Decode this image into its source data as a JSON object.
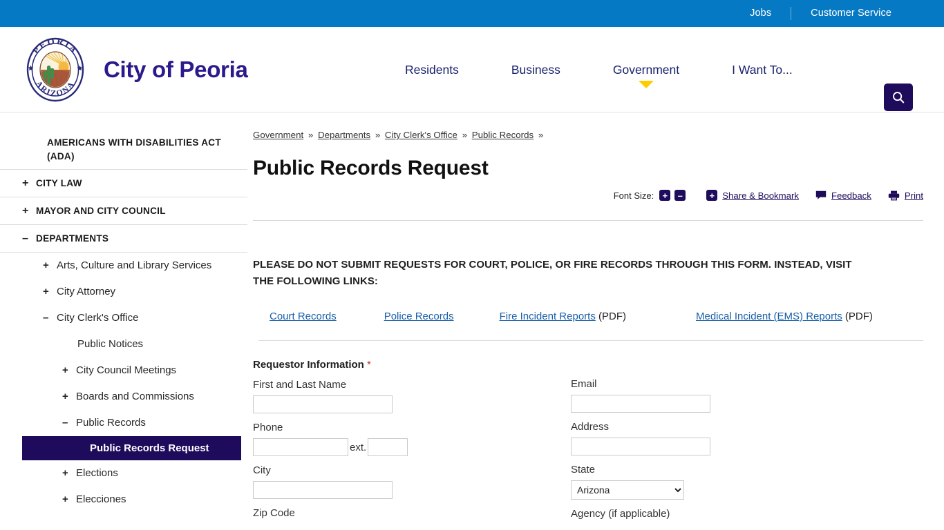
{
  "topbar": {
    "links": [
      {
        "label": "Jobs"
      },
      {
        "label": "Customer Service"
      }
    ]
  },
  "header": {
    "brand_name": "City of Peoria",
    "seal": {
      "top_text": "PEORIA",
      "bottom_text": "ARIZONA"
    },
    "nav": [
      {
        "label": "Residents",
        "active": false
      },
      {
        "label": "Business",
        "active": false
      },
      {
        "label": "Government",
        "active": true
      },
      {
        "label": "I Want To...",
        "active": false
      }
    ],
    "search_icon": "search-icon"
  },
  "sidebar": {
    "items": [
      {
        "label": "AMERICANS WITH DISABILITIES ACT (ADA)",
        "toggle": "",
        "level": 0
      },
      {
        "label": "CITY LAW",
        "toggle": "+",
        "level": 0
      },
      {
        "label": "MAYOR AND CITY COUNCIL",
        "toggle": "+",
        "level": 0
      },
      {
        "label": "DEPARTMENTS",
        "toggle": "–",
        "level": 0
      },
      {
        "label": "Arts, Culture and Library Services",
        "toggle": "+",
        "level": 1
      },
      {
        "label": "City Attorney",
        "toggle": "+",
        "level": 1
      },
      {
        "label": "City Clerk's Office",
        "toggle": "–",
        "level": 1
      },
      {
        "label": "Public Notices",
        "toggle": "",
        "level": 2
      },
      {
        "label": "City Council Meetings",
        "toggle": "+",
        "level": 2
      },
      {
        "label": "Boards and Commissions",
        "toggle": "+",
        "level": 2
      },
      {
        "label": "Public Records",
        "toggle": "–",
        "level": 2
      },
      {
        "label": "Public Records Request",
        "toggle": "",
        "level": 3,
        "active": true
      },
      {
        "label": "Elections",
        "toggle": "+",
        "level": 2
      },
      {
        "label": "Elecciones",
        "toggle": "+",
        "level": 2
      }
    ]
  },
  "breadcrumb": {
    "items": [
      "Government",
      "Departments",
      "City Clerk's Office",
      "Public Records"
    ],
    "separator": "»",
    "trailing": "»"
  },
  "main": {
    "title": "Public Records Request",
    "toolbar": {
      "font_size_label": "Font Size:",
      "increase": "+",
      "decrease": "–",
      "share_label": "Share & Bookmark",
      "feedback_label": "Feedback",
      "print_label": "Print"
    },
    "notice": "PLEASE DO NOT SUBMIT REQUESTS FOR COURT, POLICE, OR FIRE RECORDS THROUGH THIS FORM. INSTEAD, VISIT THE FOLLOWING LINKS:",
    "quick_links": [
      {
        "label": "Court Records",
        "suffix": ""
      },
      {
        "label": "Police Records",
        "suffix": ""
      },
      {
        "label": "Fire Incident Reports",
        "suffix": " (PDF)"
      },
      {
        "label": "Medical Incident (EMS) Reports",
        "suffix": " (PDF)"
      }
    ],
    "form": {
      "section_title": "Requestor Information",
      "required_mark": "*",
      "left": {
        "name_label": "First and Last Name",
        "name_value": "",
        "phone_label": "Phone",
        "phone_value": "",
        "ext_label": "ext.",
        "ext_value": "",
        "city_label": "City",
        "city_value": "",
        "zip_label": "Zip Code"
      },
      "right": {
        "email_label": "Email",
        "email_value": "",
        "address_label": "Address",
        "address_value": "",
        "state_label": "State",
        "state_value": "Arizona",
        "state_options": [
          "Arizona"
        ],
        "agency_label": "Agency (if applicable)"
      }
    }
  },
  "colors": {
    "topbar_blue": "#0679c4",
    "brand_purple": "#2a1a8c",
    "nav_navy": "#18216b",
    "accent_navy": "#1f0b5c",
    "caret_yellow": "#ffcc00",
    "link_blue": "#1a5fa8",
    "required_red": "#c0392b"
  }
}
